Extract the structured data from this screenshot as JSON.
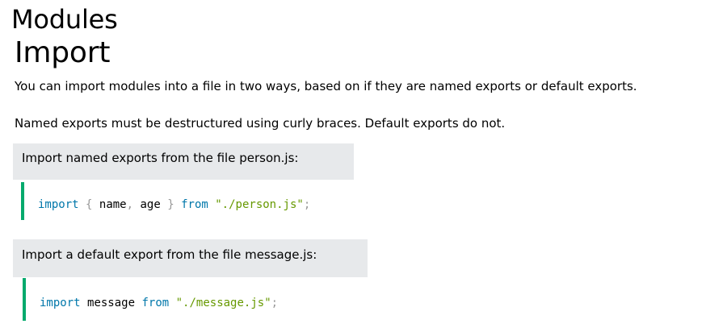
{
  "headings": {
    "section": "Modules",
    "subsection": "Import"
  },
  "paragraphs": [
    "You can import modules into a file in two ways, based on if they are named exports or default exports.",
    "Named exports must be destructured using curly braces. Default exports do not."
  ],
  "examples": [
    {
      "caption": "Import named exports from the file person.js:",
      "code": {
        "kw_import": "import",
        "brace_open": "{",
        "name": "name",
        "comma": ",",
        "age": "age",
        "brace_close": "}",
        "kw_from": "from",
        "path": "\"./person.js\"",
        "semi": ";"
      }
    },
    {
      "caption": "Import a default export from the file message.js:",
      "code": {
        "kw_import": "import",
        "ident": "message",
        "kw_from": "from",
        "path": "\"./message.js\"",
        "semi": ";"
      }
    }
  ],
  "colors": {
    "keyword": "#0077aa",
    "punctuation": "#999999",
    "string": "#669900",
    "accent_border": "#04aa6d",
    "note_background": "#e7e9eb"
  }
}
